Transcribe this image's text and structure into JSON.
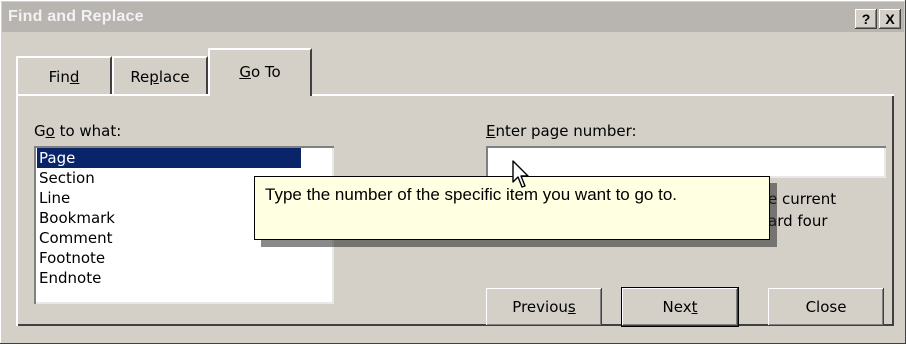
{
  "window": {
    "title": "Find and Replace",
    "help_button": "?",
    "close_button": "X"
  },
  "tabs": [
    {
      "label_pre": "Fin",
      "label_key": "d",
      "label_post": ""
    },
    {
      "label_pre": "Re",
      "label_key": "p",
      "label_post": "lace"
    },
    {
      "label_pre": "",
      "label_key": "G",
      "label_post": "o To"
    }
  ],
  "goto": {
    "label_pre": "G",
    "label_key": "o",
    "label_post": " to what:",
    "items": [
      "Page",
      "Section",
      "Line",
      "Bookmark",
      "Comment",
      "Footnote",
      "Endnote"
    ],
    "selected": "Page"
  },
  "enter": {
    "label_pre": "",
    "label_key": "E",
    "label_post": "nter page number:",
    "value": ""
  },
  "hint": {
    "line1": "e current",
    "line2": "ard four"
  },
  "tooltip": {
    "text": "Type the number of the specific item you want to go to."
  },
  "buttons": {
    "previous_pre": "Previou",
    "previous_key": "s",
    "previous_post": "",
    "next_pre": "Nex",
    "next_key": "t",
    "next_post": "",
    "close": "Close"
  },
  "colors": {
    "dialog_bg": "#d4d0c8",
    "selection": "#0a246a",
    "tooltip_bg": "#ffffe1"
  },
  "icons": {
    "scroll_up": "triangle-up",
    "scroll_down": "triangle-down",
    "cursor": "arrow-pointer"
  }
}
